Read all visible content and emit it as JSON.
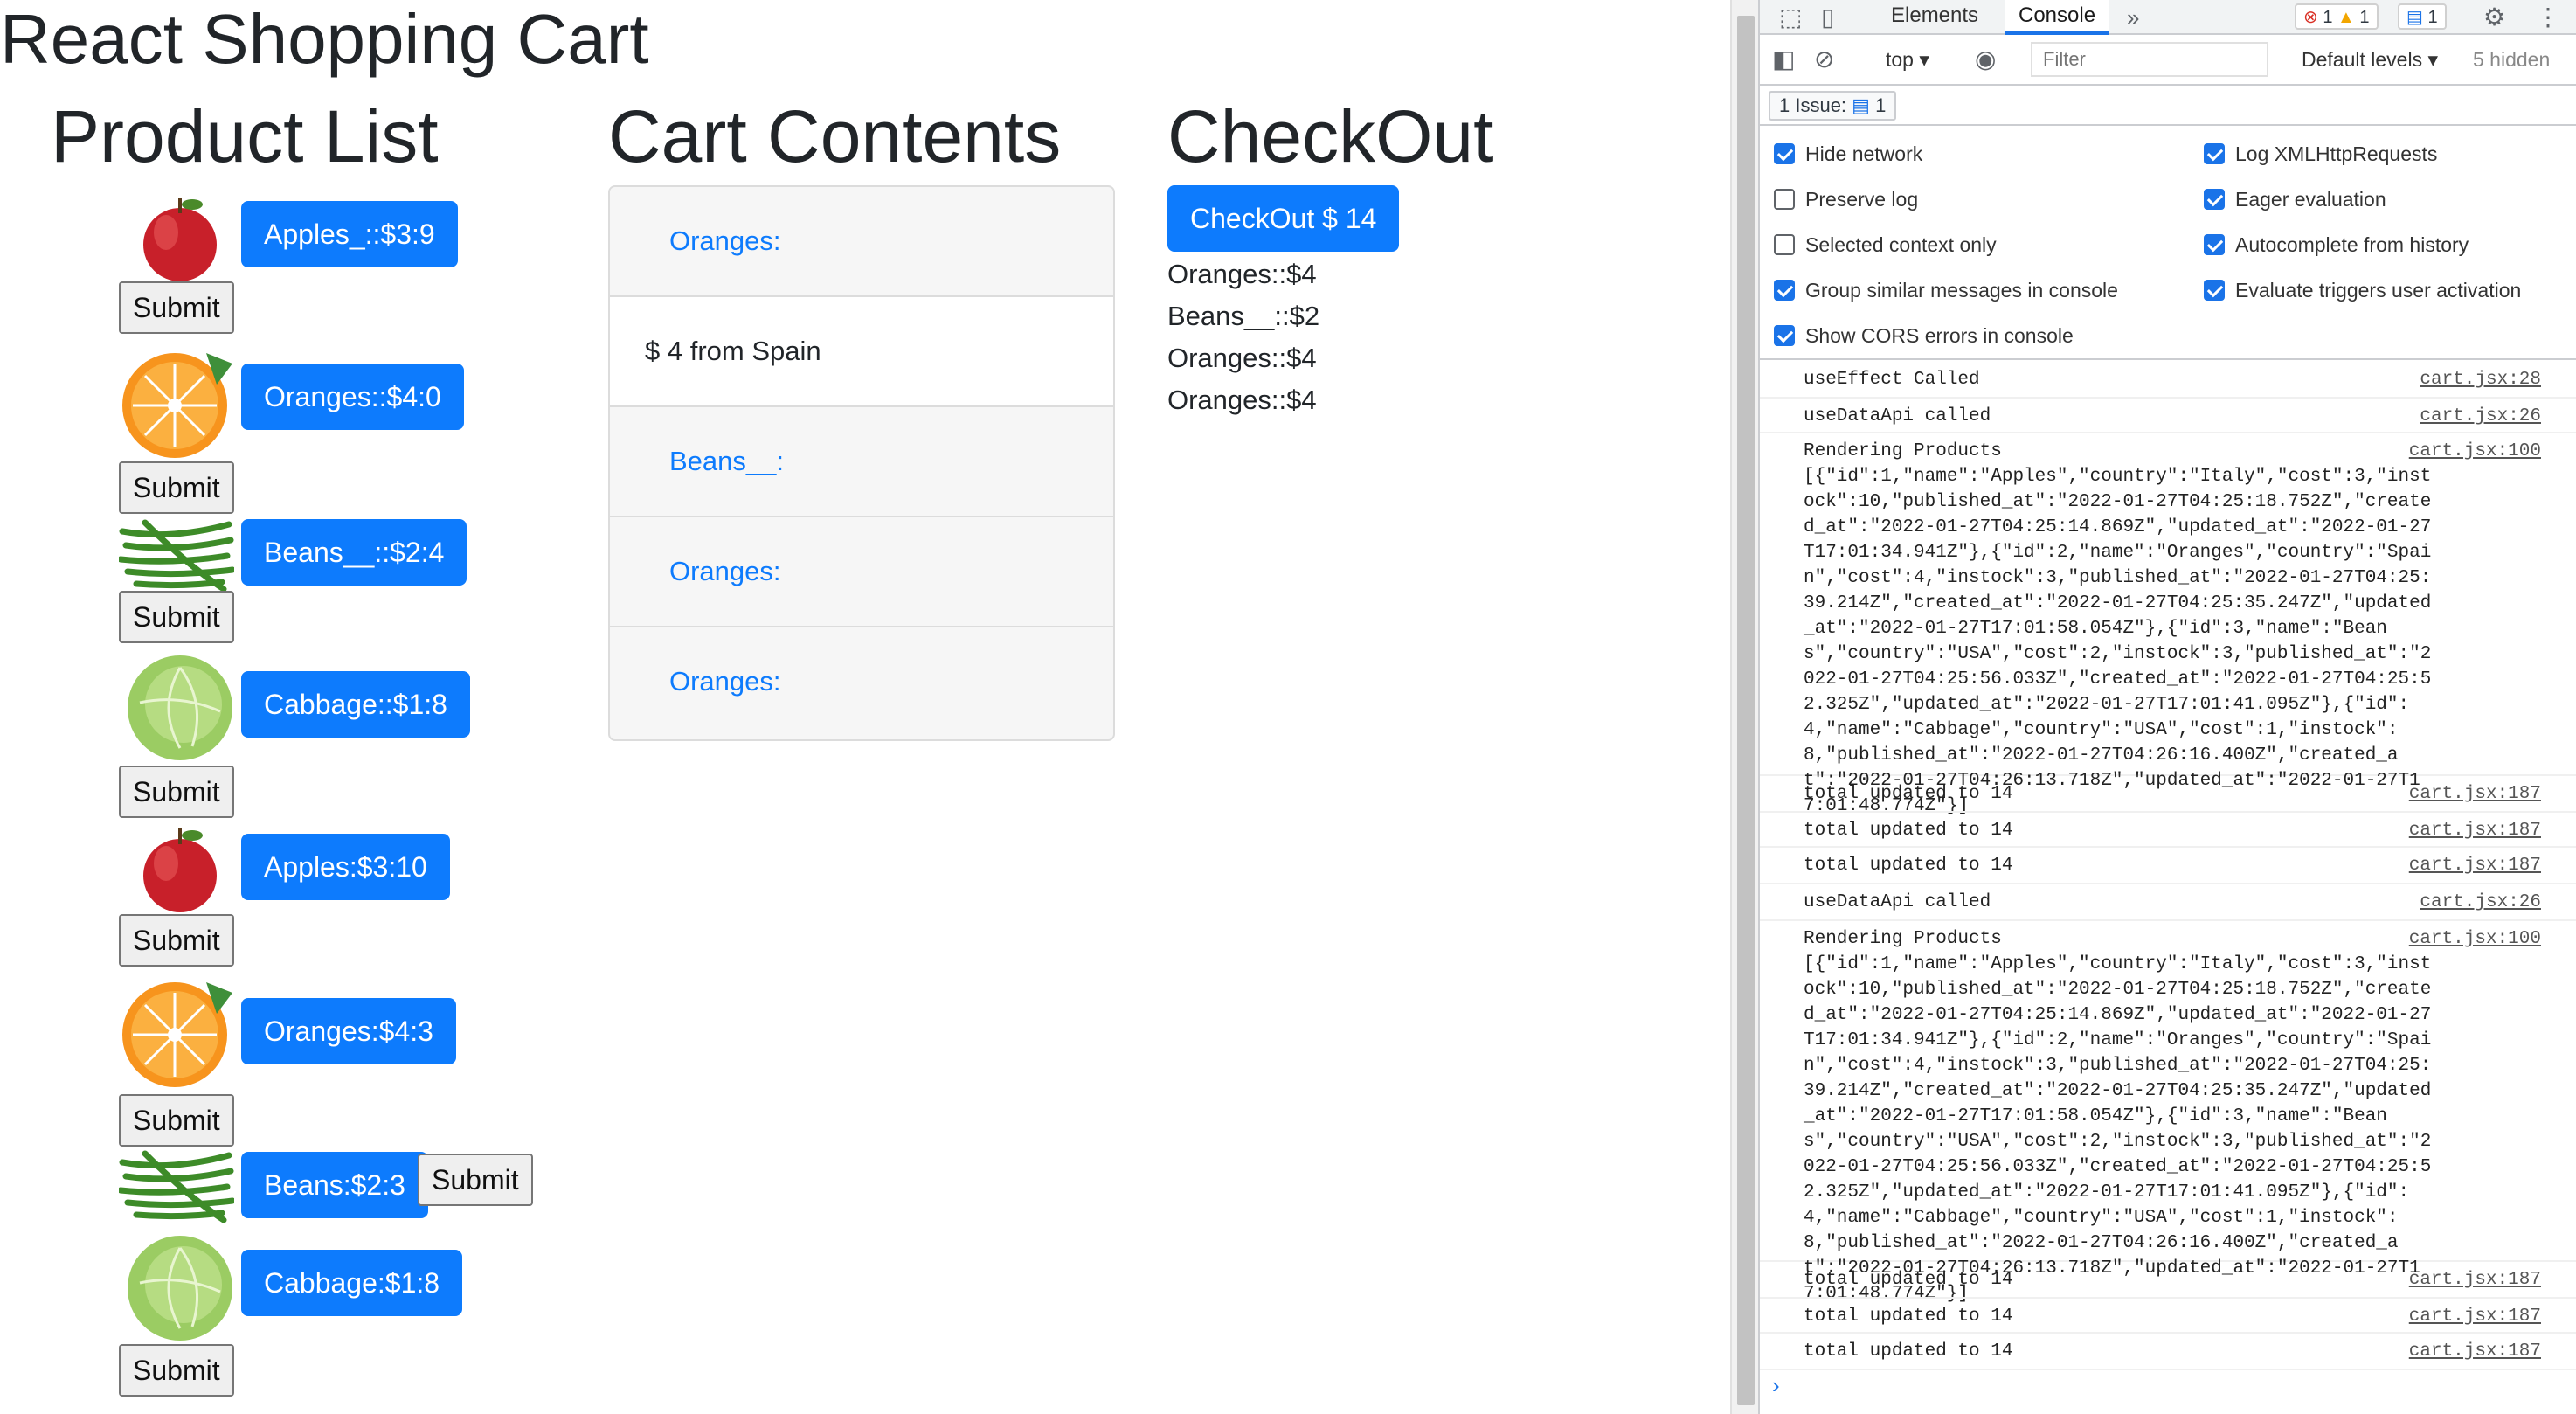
{
  "app": {
    "title": "React Shopping Cart",
    "product_list_title": "Product List",
    "cart_contents_title": "Cart Contents",
    "checkout_title": "CheckOut",
    "products": [
      {
        "label": "Apples_::$3:9",
        "image": "apple-icon"
      },
      {
        "label": "Oranges::$4:0",
        "image": "orange-icon"
      },
      {
        "label": "Beans__::$2:4",
        "image": "beans-icon"
      },
      {
        "label": "Cabbage::$1:8",
        "image": "cabbage-icon"
      },
      {
        "label": "Apples:$3:10",
        "image": "apple-icon"
      },
      {
        "label": "Oranges:$4:3",
        "image": "orange-icon"
      },
      {
        "label": "Beans:$2:3",
        "image": "beans-icon"
      },
      {
        "label": "Cabbage:$1:8",
        "image": "cabbage-icon"
      }
    ],
    "submit_label": "Submit",
    "cart_items": [
      {
        "text": "Oranges:",
        "kind": "link"
      },
      {
        "text": "$ 4 from Spain",
        "kind": "body"
      },
      {
        "text": "Beans__:",
        "kind": "link"
      },
      {
        "text": "Oranges:",
        "kind": "link"
      },
      {
        "text": "Oranges:",
        "kind": "link"
      }
    ],
    "checkout_button": "CheckOut $ 14",
    "checkout_lines": [
      "Oranges::$4",
      "Beans__::$2",
      "Oranges::$4",
      "Oranges::$4"
    ],
    "colors": {
      "primary": "#0d7bfd",
      "text": "#212529",
      "cart_bg": "#f6f6f6"
    }
  },
  "devtools": {
    "tabs": [
      "Elements",
      "Console"
    ],
    "active_tab": "Console",
    "more_tabs_icon": "double-chevron-right-icon",
    "error_count": "1",
    "warning_count": "1",
    "message_count": "1",
    "context": "top",
    "filter_placeholder": "Filter",
    "default_levels": "Default levels",
    "hidden_count": "5 hidden",
    "issue_label": "1 Issue:",
    "issue_count": "1",
    "settings_left": [
      {
        "label": "Hide network",
        "checked": true
      },
      {
        "label": "Preserve log",
        "checked": false
      },
      {
        "label": "Selected context only",
        "checked": false
      },
      {
        "label": "Group similar messages in console",
        "checked": true
      },
      {
        "label": "Show CORS errors in console",
        "checked": true
      }
    ],
    "settings_right": [
      {
        "label": "Log XMLHttpRequests",
        "checked": true
      },
      {
        "label": "Eager evaluation",
        "checked": true
      },
      {
        "label": "Autocomplete from history",
        "checked": true
      },
      {
        "label": "Evaluate triggers user activation",
        "checked": true
      }
    ],
    "logs": [
      {
        "text": "useEffect Called",
        "source": "cart.jsx:28"
      },
      {
        "text": "useDataApi called",
        "source": "cart.jsx:26"
      },
      {
        "text": "Rendering Products\n[{\"id\":1,\"name\":\"Apples\",\"country\":\"Italy\",\"cost\":3,\"instock\":10,\"published_at\":\"2022-01-27T04:25:18.752Z\",\"created_at\":\"2022-01-27T04:25:14.869Z\",\"updated_at\":\"2022-01-27T17:01:34.941Z\"},{\"id\":2,\"name\":\"Oranges\",\"country\":\"Spain\",\"cost\":4,\"instock\":3,\"published_at\":\"2022-01-27T04:25:39.214Z\",\"created_at\":\"2022-01-27T04:25:35.247Z\",\"updated_at\":\"2022-01-27T17:01:58.054Z\"},{\"id\":3,\"name\":\"Beans\",\"country\":\"USA\",\"cost\":2,\"instock\":3,\"published_at\":\"2022-01-27T04:25:56.033Z\",\"created_at\":\"2022-01-27T04:25:52.325Z\",\"updated_at\":\"2022-01-27T17:01:41.095Z\"},{\"id\":4,\"name\":\"Cabbage\",\"country\":\"USA\",\"cost\":1,\"instock\":8,\"published_at\":\"2022-01-27T04:26:16.400Z\",\"created_at\":\"2022-01-27T04:26:13.718Z\",\"updated_at\":\"2022-01-27T17:01:48.774Z\"}]",
        "source": "cart.jsx:100"
      },
      {
        "text": "total updated to 14",
        "source": "cart.jsx:187"
      },
      {
        "text": "total updated to 14",
        "source": "cart.jsx:187"
      },
      {
        "text": "total updated to 14",
        "source": "cart.jsx:187"
      },
      {
        "text": "useDataApi called",
        "source": "cart.jsx:26"
      },
      {
        "text": "Rendering Products\n[{\"id\":1,\"name\":\"Apples\",\"country\":\"Italy\",\"cost\":3,\"instock\":10,\"published_at\":\"2022-01-27T04:25:18.752Z\",\"created_at\":\"2022-01-27T04:25:14.869Z\",\"updated_at\":\"2022-01-27T17:01:34.941Z\"},{\"id\":2,\"name\":\"Oranges\",\"country\":\"Spain\",\"cost\":4,\"instock\":3,\"published_at\":\"2022-01-27T04:25:39.214Z\",\"created_at\":\"2022-01-27T04:25:35.247Z\",\"updated_at\":\"2022-01-27T17:01:58.054Z\"},{\"id\":3,\"name\":\"Beans\",\"country\":\"USA\",\"cost\":2,\"instock\":3,\"published_at\":\"2022-01-27T04:25:56.033Z\",\"created_at\":\"2022-01-27T04:25:52.325Z\",\"updated_at\":\"2022-01-27T17:01:41.095Z\"},{\"id\":4,\"name\":\"Cabbage\",\"country\":\"USA\",\"cost\":1,\"instock\":8,\"published_at\":\"2022-01-27T04:26:16.400Z\",\"created_at\":\"2022-01-27T04:26:13.718Z\",\"updated_at\":\"2022-01-27T17:01:48.774Z\"}]",
        "source": "cart.jsx:100"
      },
      {
        "text": "total updated to 14",
        "source": "cart.jsx:187"
      },
      {
        "text": "total updated to 14",
        "source": "cart.jsx:187"
      },
      {
        "text": "total updated to 14",
        "source": "cart.jsx:187"
      }
    ],
    "prompt_symbol": "›"
  }
}
